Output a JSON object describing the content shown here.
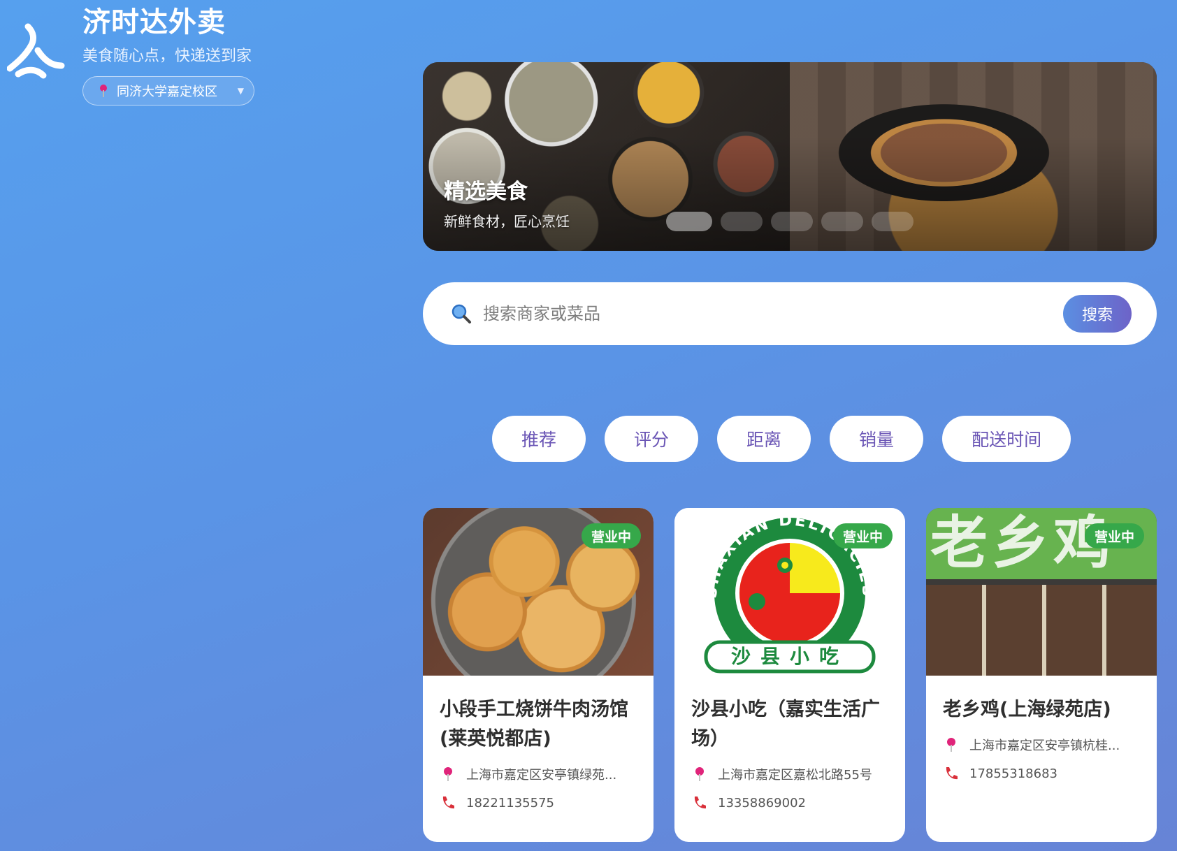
{
  "header": {
    "app_name": "济时达外卖",
    "slogan": "美食随心点，快递送到家",
    "location": "同济大学嘉定校区",
    "location_icon": "map-pin-icon",
    "dropdown_icon": "chevron-down-icon"
  },
  "banner": {
    "title": "精选美食",
    "subtitle": "新鲜食材，匠心烹饪",
    "slide_count": 5,
    "active_slide": 1
  },
  "search": {
    "placeholder": "搜索商家或菜品",
    "button_label": "搜索"
  },
  "sort_tabs": [
    {
      "label": "推荐"
    },
    {
      "label": "评分"
    },
    {
      "label": "距离"
    },
    {
      "label": "销量"
    },
    {
      "label": "配送时间"
    }
  ],
  "restaurants": [
    {
      "name": "小段手工烧饼牛肉汤馆(莱英悦都店)",
      "status": "营业中",
      "address": "上海市嘉定区安亭镇绿苑...",
      "phone": "18221135575"
    },
    {
      "name": "沙县小吃（嘉实生活广场）",
      "status": "营业中",
      "address": "上海市嘉定区嘉松北路55号",
      "phone": "13358869002",
      "logo_ring_text": "SHAXIAN DELICACIES",
      "logo_bottom_text": "沙县小吃"
    },
    {
      "name": "老乡鸡(上海绿苑店)",
      "status": "营业中",
      "address": "上海市嘉定区安亭镇杭桂...",
      "phone": "17855318683",
      "sign_text": "老乡鸡"
    }
  ],
  "colors": {
    "accent": "#6a55b5",
    "open_badge": "#36a84a",
    "pin": "#e0247a",
    "phone": "#d9303a"
  }
}
